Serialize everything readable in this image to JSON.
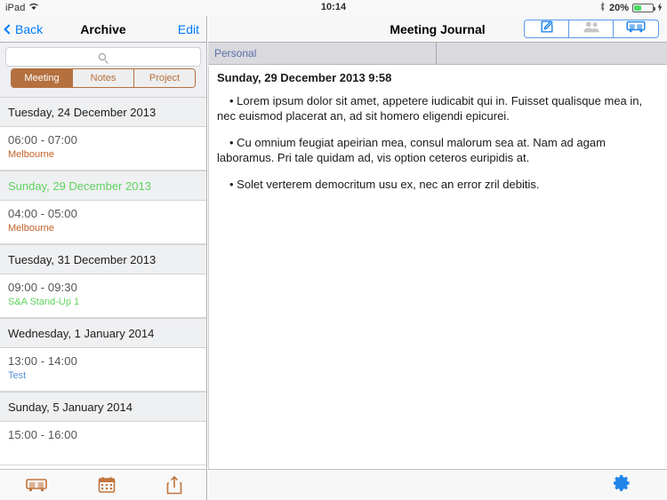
{
  "status_bar": {
    "device": "iPad",
    "wifi_icon": "wifi-icon",
    "time": "10:14",
    "bluetooth_icon": "bluetooth-icon",
    "battery_percent": "20%",
    "charging_icon": "lightning-bolt-icon"
  },
  "sidebar": {
    "back_label": "Back",
    "title": "Archive",
    "edit_label": "Edit",
    "search": {
      "placeholder": "",
      "icon": "search-icon"
    },
    "segments": [
      {
        "label": "Meeting",
        "selected": true
      },
      {
        "label": "Notes",
        "selected": false
      },
      {
        "label": "Project",
        "selected": false
      }
    ],
    "sections": [
      {
        "header": "Tuesday, 24 December 2013",
        "header_color": "#1d1d1d",
        "rows": [
          {
            "time": "06:00 - 07:00",
            "subtitle": "Melbourne",
            "subtitle_color": "#c2622c"
          }
        ]
      },
      {
        "header": "Sunday, 29 December 2013",
        "header_color": "#5fd35f",
        "rows": [
          {
            "time": "04:00 - 05:00",
            "subtitle": "Melbourne",
            "subtitle_color": "#c2622c"
          }
        ]
      },
      {
        "header": "Tuesday, 31 December 2013",
        "header_color": "#1d1d1d",
        "rows": [
          {
            "time": "09:00 - 09:30",
            "subtitle": "S&A Stand-Up 1",
            "subtitle_color": "#5fd35f"
          }
        ]
      },
      {
        "header": "Wednesday, 1 January 2014",
        "header_color": "#1d1d1d",
        "rows": [
          {
            "time": "13:00 - 14:00",
            "subtitle": "Test",
            "subtitle_color": "#5b8fd6"
          }
        ]
      },
      {
        "header": "Sunday, 5 January 2014",
        "header_color": "#1d1d1d",
        "rows": [
          {
            "time": "15:00 - 16:00",
            "subtitle": "",
            "subtitle_color": "#c2622c"
          }
        ]
      }
    ],
    "toolbar": [
      {
        "icon": "projector-icon",
        "color": "#c2743f"
      },
      {
        "icon": "calendar-icon",
        "color": "#c2743f"
      },
      {
        "icon": "share-icon",
        "color": "#c2743f"
      }
    ]
  },
  "detail": {
    "title": "Meeting Journal",
    "buttons": [
      {
        "icon": "compose-icon",
        "state": "enabled",
        "color": "#2185e8"
      },
      {
        "icon": "people-icon",
        "state": "disabled",
        "color": "#c6c6c6"
      },
      {
        "icon": "projector-icon",
        "state": "enabled",
        "color": "#2185e8"
      }
    ],
    "tabs": [
      {
        "label": "Personal",
        "selected": true
      },
      {
        "label": "",
        "selected": false
      }
    ],
    "note": {
      "heading": "Sunday, 29 December 2013 9:58",
      "paragraphs": [
        "• Lorem ipsum dolor sit amet, appetere iudicabit qui in. Fuisset qualisque mea in, nec euismod placerat an, ad sit homero eligendi epicurei.",
        "• Cu omnium feugiat apeirian mea, consul malorum sea at. Nam ad agam laboramus. Pri tale quidam ad, vis option ceteros euripidis at.",
        "• Solet verterem democritum usu ex, nec an error zril debitis."
      ]
    },
    "toolbar": [
      {
        "icon": "gear-icon",
        "color": "#2185e8"
      }
    ]
  },
  "colors": {
    "accent_brown": "#b5703f",
    "accent_blue": "#007aff",
    "accent_green": "#5fd35f"
  }
}
